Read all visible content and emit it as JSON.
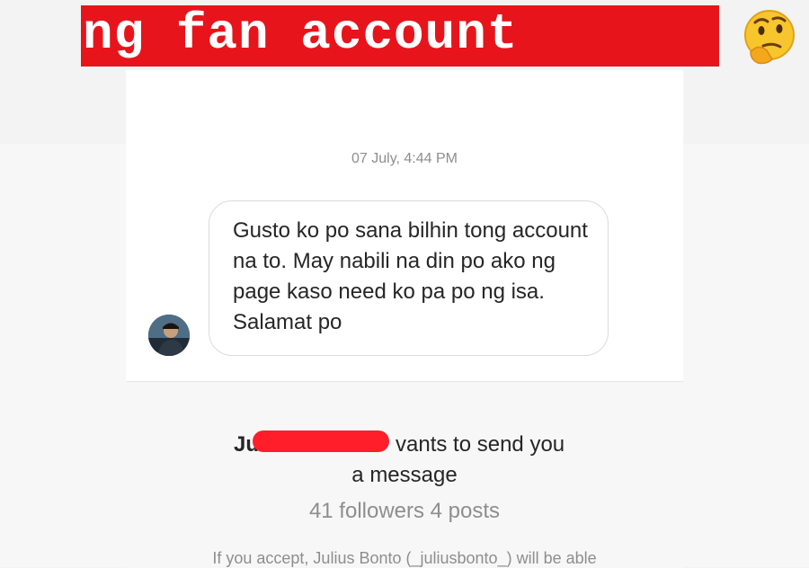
{
  "banner": {
    "text": "ng fan account",
    "emoji_icon": "thinking-face-icon",
    "background_color": "#e8141c"
  },
  "chat": {
    "timestamp": "07 July, 4:44 PM",
    "message": "Gusto ko po sana bilhin tong account na to.  May nabili na din po ako ng page kaso need ko pa po ng isa. Salamat po"
  },
  "request": {
    "name_fragment": "Ju",
    "line1_suffix": "vants to send you",
    "line2": "a message",
    "stats": "41 followers 4 posts",
    "footer_note": "If you accept, Julius Bonto (_juliusbonto_) will be able"
  }
}
